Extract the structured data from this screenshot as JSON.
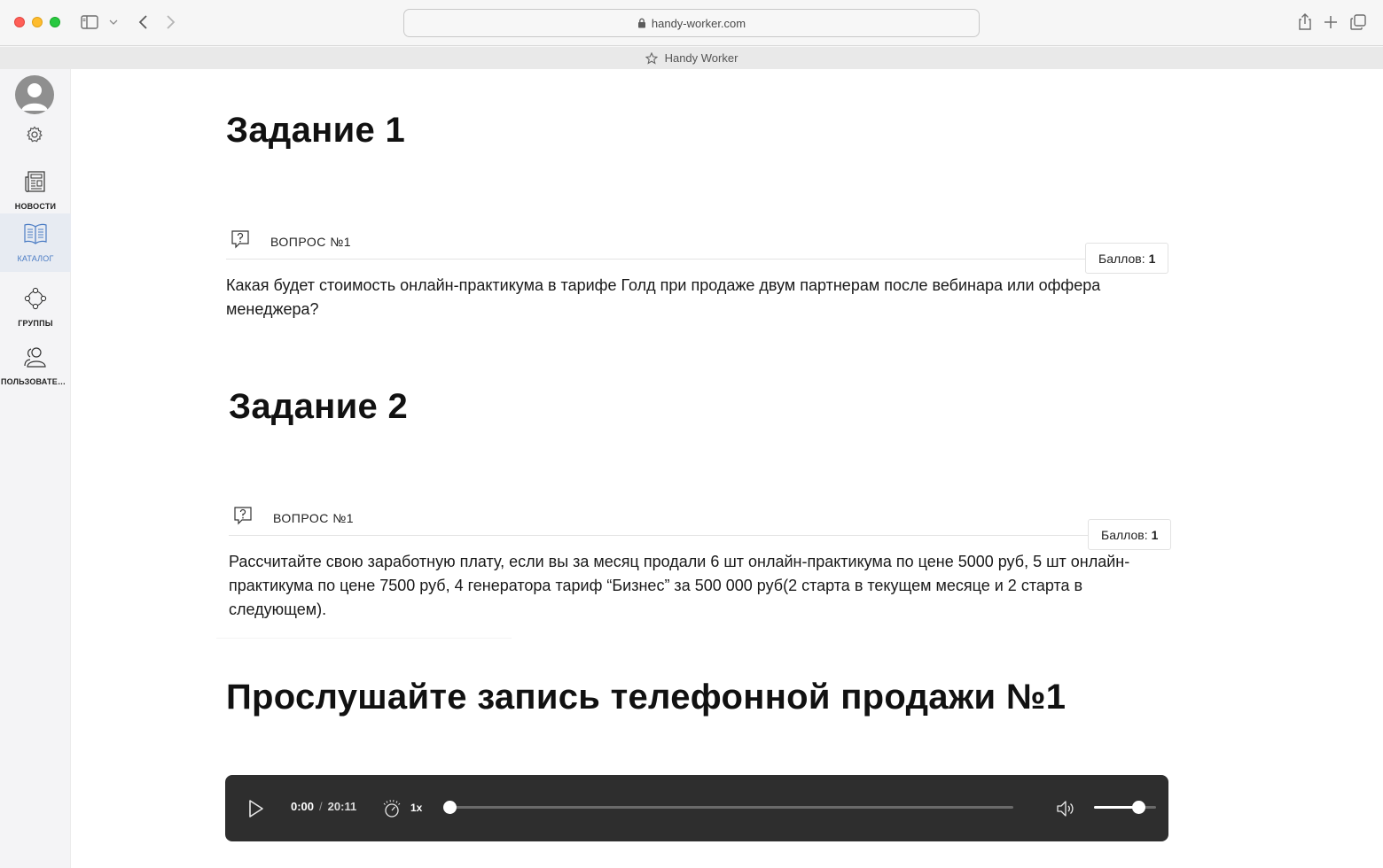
{
  "browser": {
    "url": "handy-worker.com",
    "tab_title": "Handy Worker"
  },
  "sidebar": {
    "items": [
      {
        "label": "НОВОСТИ",
        "icon": "newspaper-icon"
      },
      {
        "label": "КАТАЛОГ",
        "icon": "book-icon",
        "active": true
      },
      {
        "label": "ГРУППЫ",
        "icon": "group-icon"
      },
      {
        "label": "ПОЛЬЗОВАТЕЛ...",
        "icon": "users-icon"
      }
    ]
  },
  "tasks": [
    {
      "title": "Задание 1",
      "question_label": "ВОПРОС №1",
      "points_label": "Баллов:",
      "points_value": "1",
      "text": "Какая будет стоимость онлайн-практикума в тарифе Голд при продаже двум партнерам после вебинара или оффера менеджера?"
    },
    {
      "title": "Задание 2",
      "question_label": "ВОПРОС №1",
      "points_label": "Баллов:",
      "points_value": "1",
      "text": "Рассчитайте свою заработную плату, если вы за месяц продали 6 шт онлайн-практикума по цене 5000 руб, 5 шт онлайн-практикума по цене 7500 руб, 4 генератора тариф “Бизнес” за 500 000 руб(2 старта в текущем месяце и 2 старта в следующем)."
    }
  ],
  "audio_section": {
    "title": "Прослушайте запись телефонной продажи №1",
    "player": {
      "current_time": "0:00",
      "separator": "/",
      "duration": "20:11",
      "speed": "1x",
      "progress": 0.0,
      "volume": 0.72
    }
  }
}
